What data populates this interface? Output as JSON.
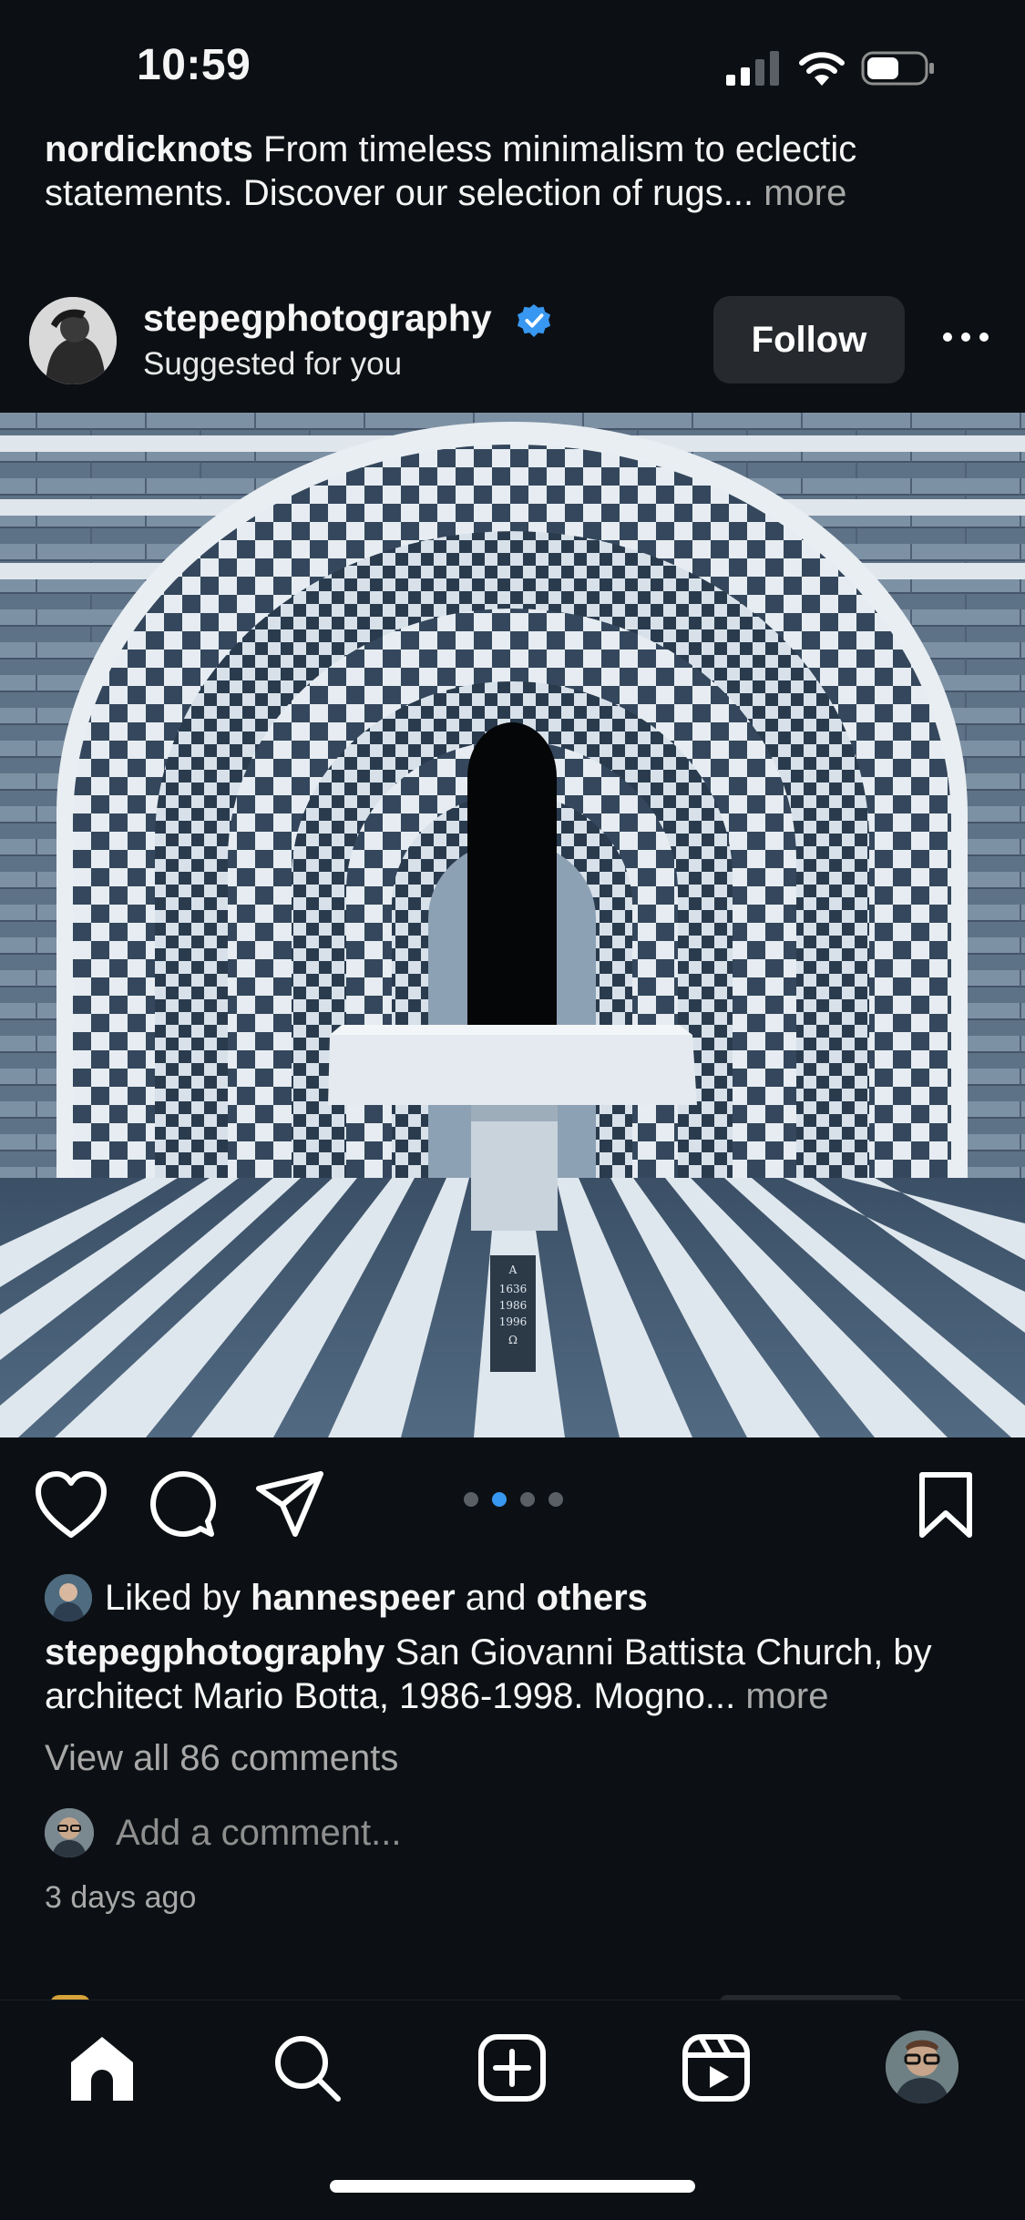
{
  "status_bar": {
    "time": "10:59"
  },
  "previous_post": {
    "username": "nordicknots",
    "caption": "From timeless minimalism to eclectic statements. Discover our selection of rugs...",
    "more_label": "more"
  },
  "post": {
    "username": "stepegphotography",
    "subtitle": "Suggested for you",
    "follow_label": "Follow",
    "photo_plaque_lines": [
      "A",
      "1636",
      "1986",
      "1996",
      "Ω"
    ],
    "carousel": {
      "count": 4,
      "active_index": 1
    },
    "likes": {
      "prefix": "Liked by",
      "user": "hannespeer",
      "joiner": "and",
      "others": "others"
    },
    "caption": {
      "username": "stepegphotography",
      "text": "San Giovanni Battista Church, by architect Mario Botta, 1986-1998. Mogno...",
      "more_label": "more"
    },
    "view_comments": "View all 86 comments",
    "add_comment_placeholder": "Add a comment...",
    "timestamp": "3 days ago"
  },
  "colors": {
    "background": "#0c1014",
    "text": "#f5f5f5",
    "muted": "#a8a8a8",
    "button": "#26292e",
    "verified": "#3897f0",
    "carousel_active": "#3897f0",
    "carousel_inactive": "#5a5f66"
  },
  "icons": {
    "like": "heart-icon",
    "comment": "comment-bubble-icon",
    "share": "paper-plane-icon",
    "save": "bookmark-icon",
    "more": "ellipsis-icon",
    "verified": "verified-badge-icon",
    "nav": [
      "home-icon",
      "search-icon",
      "create-plus-icon",
      "reels-icon",
      "profile-avatar"
    ]
  }
}
